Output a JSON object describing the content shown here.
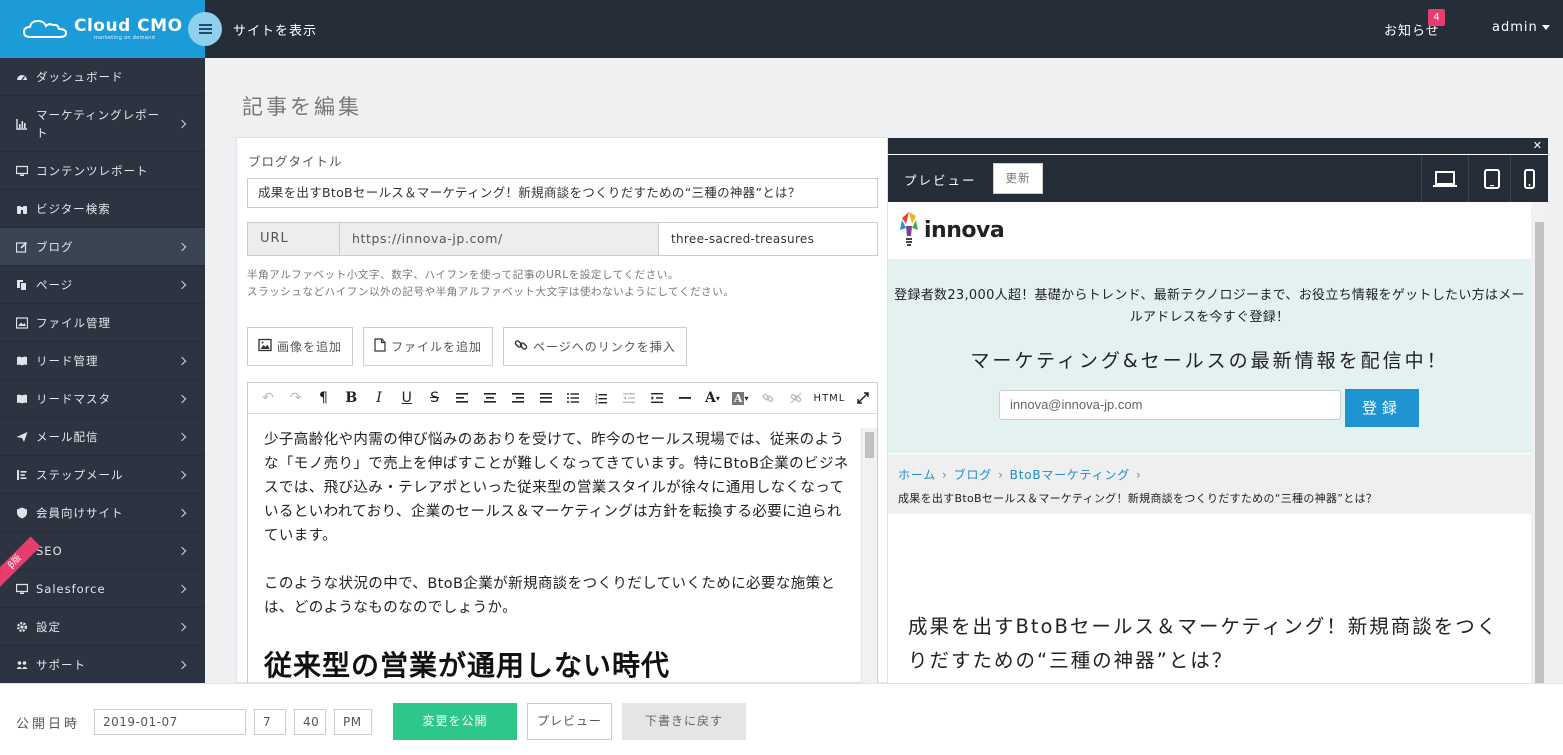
{
  "header": {
    "brand": "Cloud CMO",
    "brand_sub": "marketing on demand",
    "site_link": "サイトを表示",
    "notifications_label": "お知らせ",
    "notifications_count": "4",
    "user": "admin"
  },
  "sidebar": {
    "ribbon": "β版",
    "items": [
      {
        "label": "ダッシュボード",
        "icon": "dashboard-icon"
      },
      {
        "label": "マーケティングレポート",
        "icon": "bar-chart-icon"
      },
      {
        "label": "コンテンツレポート",
        "icon": "monitor-icon"
      },
      {
        "label": "ビジター検索",
        "icon": "binoculars-icon"
      },
      {
        "label": "ブログ",
        "icon": "edit-icon"
      },
      {
        "label": "ページ",
        "icon": "pages-icon"
      },
      {
        "label": "ファイル管理",
        "icon": "image-icon"
      },
      {
        "label": "リード管理",
        "icon": "book-icon"
      },
      {
        "label": "リードマスタ",
        "icon": "book-icon"
      },
      {
        "label": "メール配信",
        "icon": "send-icon"
      },
      {
        "label": "ステップメール",
        "icon": "list-icon"
      },
      {
        "label": "会員向けサイト",
        "icon": "shield-icon"
      },
      {
        "label": "SEO",
        "icon": "signal-icon"
      },
      {
        "label": "Salesforce",
        "icon": "monitor-icon"
      },
      {
        "label": "設定",
        "icon": "gear-icon"
      },
      {
        "label": "サポート",
        "icon": "users-icon"
      }
    ]
  },
  "main": {
    "page_title": "記事を編集",
    "blog_title_label": "ブログタイトル",
    "blog_title": "成果を出すBtoBセールス＆マーケティング！新規商談をつくりだすための“三種の神器”とは？",
    "url_label": "URL",
    "url_base": "https://innova-jp.com/",
    "url_slug": "three-sacred-treasures",
    "help_line1": "半角アルファベット小文字、数字、ハイフンを使って記事のURLを設定してください。",
    "help_line2": "スラッシュなどハイフン以外の記号や半角アルファベット大文字は使わないようにしてください。",
    "add_image": "画像を追加",
    "add_file": "ファイルを追加",
    "insert_link": "ページへのリンクを挿入",
    "html_button": "HTML",
    "content": {
      "p1": "少子高齢化や内需の伸び悩みのあおりを受けて、昨今のセールス現場では、従来のような「モノ売り」で売上を伸ばすことが難しくなってきています。特にBtoB企業のビジネスでは、飛び込み・テレアポといった従来型の営業スタイルが徐々に通用しなくなっているといわれており、企業のセールス＆マーケティングは方針を転換する必要に迫られています。",
      "p2": "このような状況の中で、BtoB企業が新規商談をつくりだしていくために必要な施策とは、どのようなものなのでしょうか。",
      "h2": "従来型の営業が通用しない時代"
    }
  },
  "preview": {
    "label": "プレビュー",
    "refresh": "更新",
    "site_logo": "innova",
    "banner_text": "登録者数23,000人超！基礎からトレンド、最新テクノロジーまで、お役立ち情報をゲットしたい方はメールアドレスを今すぐ登録！",
    "banner_heading": "マーケティング&セールスの最新情報を配信中！",
    "email_placeholder": "innova@innova-jp.com",
    "register": "登録",
    "crumbs": [
      "ホーム",
      "ブログ",
      "BtoBマーケティング"
    ],
    "crumb_current": "成果を出すBtoBセールス＆マーケティング！新規商談をつくりだすための“三種の神器”とは？",
    "article_title": "成果を出すBtoBセールス＆マーケティング！新規商談をつくりだすための“三種の神器”とは？"
  },
  "footer": {
    "publish_label": "公開日時",
    "date": "2019-01-07",
    "hour": "7",
    "minute": "40",
    "ampm": "PM",
    "publish_changes": "変更を公開",
    "preview": "プレビュー",
    "revert_draft": "下書きに戻す"
  },
  "colors": {
    "brand_blue": "#1b9bd7",
    "topbar": "#252d38",
    "sidebar": "#2b3440",
    "publish_green": "#2ec78a",
    "register_blue": "#1e94d2",
    "badge_pink": "#e53e6e"
  }
}
